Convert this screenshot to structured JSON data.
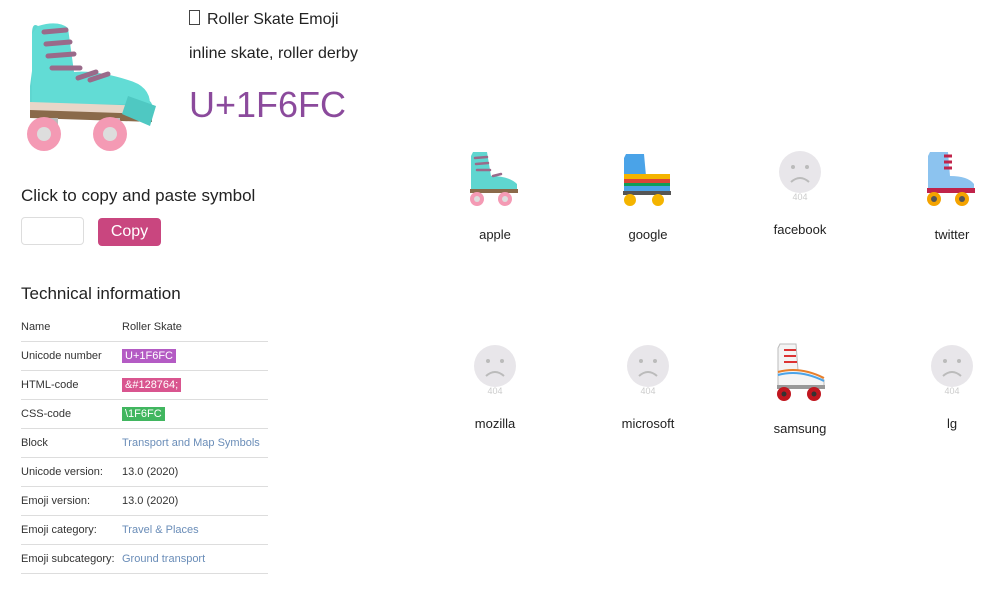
{
  "header": {
    "title": "Roller Skate Emoji",
    "keywords": "inline skate, roller derby",
    "codepoint": "U+1F6FC"
  },
  "copy": {
    "label": "Click to copy and paste symbol",
    "input_value": "",
    "button": "Copy"
  },
  "technical": {
    "title": "Technical information",
    "rows": [
      {
        "key": "Name",
        "value": "Roller Skate"
      },
      {
        "key": "Unicode number",
        "value": "U+1F6FC"
      },
      {
        "key": "HTML-code",
        "value": "&#128764;"
      },
      {
        "key": "CSS-code",
        "value": "\\1F6FC"
      },
      {
        "key": "Block",
        "value": "Transport and Map Symbols"
      },
      {
        "key": "Unicode version:",
        "value": "13.0 (2020)"
      },
      {
        "key": "Emoji version:",
        "value": "13.0 (2020)"
      },
      {
        "key": "Emoji category:",
        "value": "Travel & Places"
      },
      {
        "key": "Emoji subcategory:",
        "value": "Ground transport"
      }
    ]
  },
  "vendors": [
    {
      "name": "apple",
      "status": "image"
    },
    {
      "name": "google",
      "status": "image"
    },
    {
      "name": "facebook",
      "status": "404"
    },
    {
      "name": "twitter",
      "status": "image"
    },
    {
      "name": "mozilla",
      "status": "404"
    },
    {
      "name": "microsoft",
      "status": "404"
    },
    {
      "name": "samsung",
      "status": "image"
    },
    {
      "name": "lg",
      "status": "404"
    }
  ],
  "colors": {
    "codepoint": "#8b4a9c",
    "copy_button": "#c9467f",
    "unicode_tag": "#b45bc4",
    "html_tag": "#d9558f",
    "css_tag": "#41b65f",
    "link": "#6a8db8"
  }
}
